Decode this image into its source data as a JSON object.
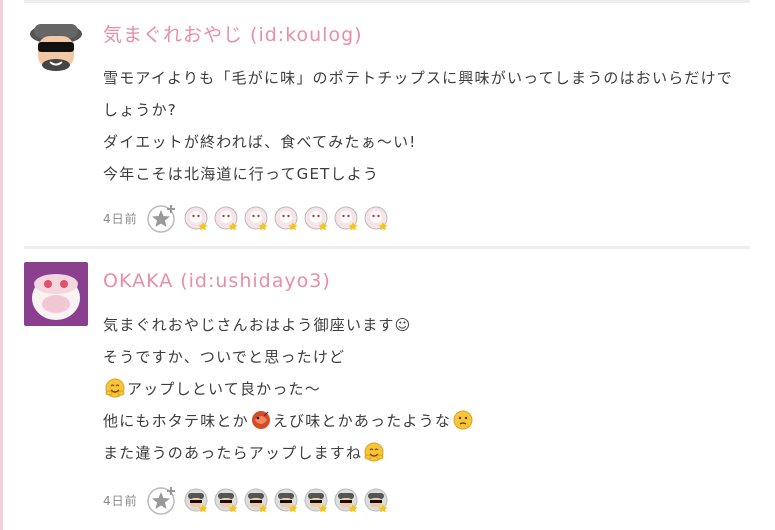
{
  "comments": [
    {
      "author": "気まぐれおやじ (id:koulog)",
      "lines": [
        "雪モアイよりも「毛がに味」のポテトチップスに興味がいってしまうのはおいらだけで",
        "しょうか?",
        "ダイエットが終われば、食べてみたぁ〜い!",
        "今年こそは北海道に行ってGETしよう"
      ],
      "time": "4日前"
    },
    {
      "author": "OKAKA (id:ushidayo3)",
      "line1": "気まぐれおやじさんおはよう御座います☺",
      "line2": "そうですか、ついでと思ったけど",
      "line3": "アップしといて良かった〜",
      "line4a": "他にもホタテ味とか",
      "line4b": "えび味とかあったような",
      "line5": "また違うのあったらアップしますね",
      "time": "4日前"
    }
  ],
  "colors": {
    "author": "#e98ea8",
    "divider": "#eeeeee",
    "star": "#f5c518"
  }
}
